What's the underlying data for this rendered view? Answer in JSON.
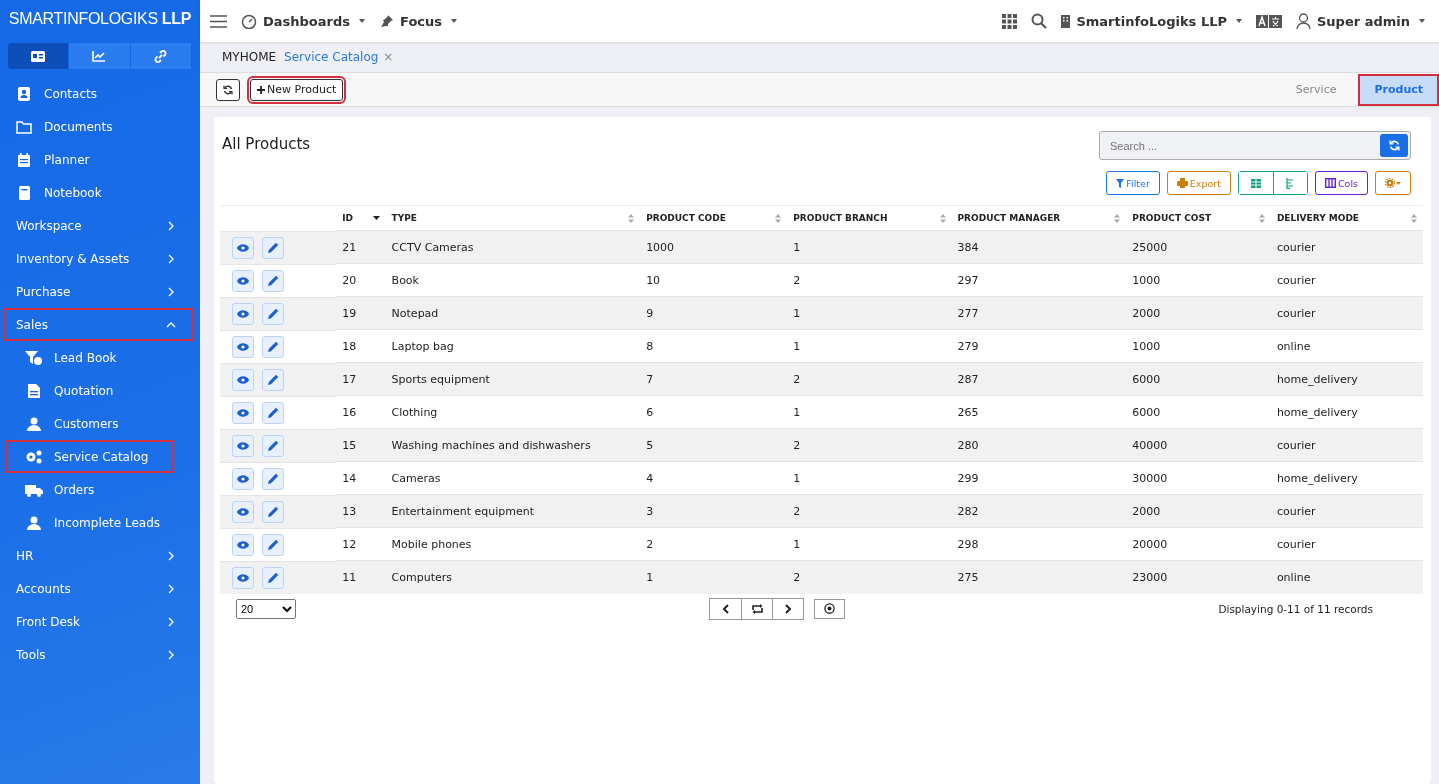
{
  "brand": {
    "name": "SMARTINFOLOGIKS",
    "suffix": "LLP"
  },
  "sidebar": {
    "tabs": [
      {
        "selected": true
      },
      {
        "selected": false
      },
      {
        "selected": false
      }
    ],
    "links": [
      "Contacts",
      "Documents",
      "Planner",
      "Notebook"
    ],
    "groups": [
      {
        "label": "Workspace",
        "expanded": false,
        "highlighted": false
      },
      {
        "label": "Inventory & Assets",
        "expanded": false,
        "highlighted": false
      },
      {
        "label": "Purchase",
        "expanded": false,
        "highlighted": false
      },
      {
        "label": "Sales",
        "expanded": true,
        "highlighted": true,
        "children": [
          {
            "label": "Lead Book",
            "highlighted": false
          },
          {
            "label": "Quotation",
            "highlighted": false
          },
          {
            "label": "Customers",
            "highlighted": false
          },
          {
            "label": "Service Catalog",
            "highlighted": true
          },
          {
            "label": "Orders",
            "highlighted": false
          },
          {
            "label": "Incomplete Leads",
            "highlighted": false
          }
        ]
      },
      {
        "label": "HR",
        "expanded": false,
        "highlighted": false
      },
      {
        "label": "Accounts",
        "expanded": false,
        "highlighted": false
      },
      {
        "label": "Front Desk",
        "expanded": false,
        "highlighted": false
      },
      {
        "label": "Tools",
        "expanded": false,
        "highlighted": false
      }
    ]
  },
  "topbar": {
    "menus": [
      "Dashboards",
      "Focus"
    ],
    "company": "SmartinfoLogiks LLP",
    "user": "Super admin"
  },
  "breadcrumbs": [
    {
      "label": "MYHOME",
      "selected": false
    },
    {
      "label": "Service Catalog",
      "selected": true,
      "close": "×"
    }
  ],
  "toolbar": {
    "new_button": {
      "label": "New Product",
      "highlighted": true
    },
    "tabs": [
      {
        "label": "Service",
        "selected": false,
        "highlighted": false
      },
      {
        "label": "Product",
        "selected": true,
        "highlighted": true
      }
    ]
  },
  "panel": {
    "title": "All Products",
    "search": {
      "placeholder": "Search ..."
    },
    "buttons": [
      {
        "label": "Filter",
        "color": "#1a73e8"
      },
      {
        "label": "Export",
        "color": "#c87f0a"
      },
      {
        "label": "Cols",
        "color": "#6a1bd8"
      }
    ]
  },
  "table": {
    "columns": [
      {
        "label": "ID",
        "sorted": true
      },
      {
        "label": "TYPE",
        "sorted": false
      },
      {
        "label": "PRODUCT CODE",
        "sorted": false
      },
      {
        "label": "PRODUCT BRANCH",
        "sorted": false
      },
      {
        "label": "PRODUCT MANAGER",
        "sorted": false
      },
      {
        "label": "PRODUCT COST",
        "sorted": false
      },
      {
        "label": "DELIVERY MODE",
        "sorted": false
      }
    ],
    "rows": [
      [
        "21",
        "CCTV Cameras",
        "1000",
        "1",
        "384",
        "25000",
        "courier"
      ],
      [
        "20",
        "Book",
        "10",
        "2",
        "297",
        "1000",
        "courier"
      ],
      [
        "19",
        "Notepad",
        "9",
        "1",
        "277",
        "2000",
        "courier"
      ],
      [
        "18",
        "Laptop bag",
        "8",
        "1",
        "279",
        "1000",
        "online"
      ],
      [
        "17",
        "Sports equipment",
        "7",
        "2",
        "287",
        "6000",
        "home_delivery"
      ],
      [
        "16",
        "Clothing",
        "6",
        "1",
        "265",
        "6000",
        "home_delivery"
      ],
      [
        "15",
        "Washing machines and dishwashers",
        "5",
        "2",
        "280",
        "40000",
        "courier"
      ],
      [
        "14",
        "Cameras",
        "4",
        "1",
        "299",
        "30000",
        "home_delivery"
      ],
      [
        "13",
        "Entertainment equipment",
        "3",
        "2",
        "282",
        "2000",
        "courier"
      ],
      [
        "12",
        "Mobile phones",
        "2",
        "1",
        "298",
        "20000",
        "courier"
      ],
      [
        "11",
        "Computers",
        "1",
        "2",
        "275",
        "23000",
        "online"
      ]
    ]
  },
  "pagination": {
    "page_size": "20",
    "status": "Displaying 0-11 of 11 records"
  }
}
